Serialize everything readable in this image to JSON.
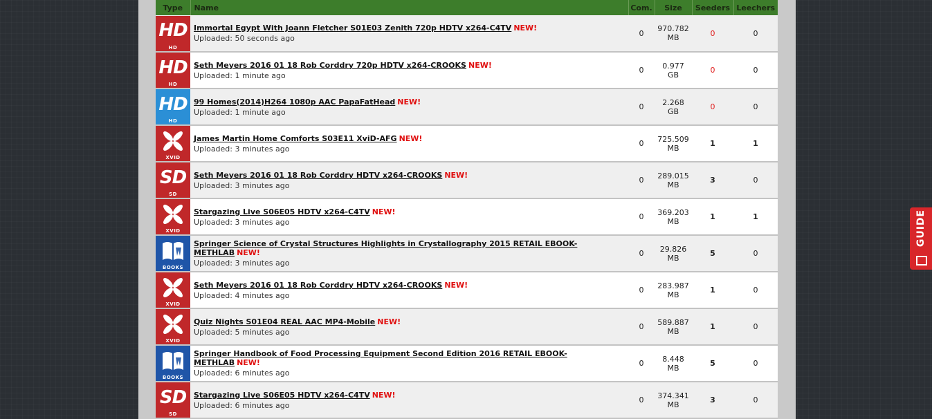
{
  "headers": {
    "type": "Type",
    "name": "Name",
    "com": "Com.",
    "size": "Size",
    "seeders": "Seeders",
    "leechers": "Leechers"
  },
  "new_label": "NEW!",
  "guide_label": "GUIDE",
  "rows": [
    {
      "icon": "hd",
      "icon_text": "HD",
      "icon_label": "HD",
      "color": "#c0282a",
      "name": "Immortal Egypt With Joann Fletcher S01E03 Zenith 720p HDTV x264-C4TV",
      "uploaded": "Uploaded: 50 seconds ago",
      "com": "0",
      "size": "970.782",
      "unit": "MB",
      "seeders": "0",
      "leechers": "0"
    },
    {
      "icon": "hd",
      "icon_text": "HD",
      "icon_label": "HD",
      "color": "#c0282a",
      "name": "Seth Meyers 2016 01 18 Rob Corddry 720p HDTV x264-CROOKS",
      "uploaded": "Uploaded: 1 minute ago",
      "com": "0",
      "size": "0.977",
      "unit": "GB",
      "seeders": "0",
      "leechers": "0"
    },
    {
      "icon": "hd",
      "icon_text": "HD",
      "icon_label": "HD",
      "color": "#2b8fd6",
      "name": "99 Homes(2014)H264 1080p AAC PapaFatHead",
      "uploaded": "Uploaded: 1 minute ago",
      "com": "0",
      "size": "2.268",
      "unit": "GB",
      "seeders": "0",
      "leechers": "0"
    },
    {
      "icon": "xvid",
      "icon_text": "",
      "icon_label": "XVID",
      "color": "#c0282a",
      "name": "James Martin Home Comforts S03E11 XviD-AFG",
      "uploaded": "Uploaded: 3 minutes ago",
      "com": "0",
      "size": "725.509",
      "unit": "MB",
      "seeders": "1",
      "leechers": "1"
    },
    {
      "icon": "sd",
      "icon_text": "SD",
      "icon_label": "SD",
      "color": "#c0282a",
      "name": "Seth Meyers 2016 01 18 Rob Corddry HDTV x264-CROOKS",
      "uploaded": "Uploaded: 3 minutes ago",
      "com": "0",
      "size": "289.015",
      "unit": "MB",
      "seeders": "3",
      "leechers": "0"
    },
    {
      "icon": "xvid",
      "icon_text": "",
      "icon_label": "XVID",
      "color": "#c0282a",
      "name": "Stargazing Live S06E05 HDTV x264-C4TV",
      "uploaded": "Uploaded: 3 minutes ago",
      "com": "0",
      "size": "369.203",
      "unit": "MB",
      "seeders": "1",
      "leechers": "1"
    },
    {
      "icon": "books",
      "icon_text": "",
      "icon_label": "BOOKS",
      "color": "#1f55a8",
      "name": "Springer Science of Crystal Structures Highlights in Crystallography 2015 RETAIL EBOOK-METHLAB",
      "uploaded": "Uploaded: 3 minutes ago",
      "com": "0",
      "size": "29.826",
      "unit": "MB",
      "seeders": "5",
      "leechers": "0"
    },
    {
      "icon": "xvid",
      "icon_text": "",
      "icon_label": "XVID",
      "color": "#c0282a",
      "name": "Seth Meyers 2016 01 18 Rob Corddry HDTV x264-CROOKS",
      "uploaded": "Uploaded: 4 minutes ago",
      "com": "0",
      "size": "283.987",
      "unit": "MB",
      "seeders": "1",
      "leechers": "0"
    },
    {
      "icon": "xvid",
      "icon_text": "",
      "icon_label": "XVID",
      "color": "#c0282a",
      "name": "Quiz Nights S01E04 REAL AAC MP4-Mobile",
      "uploaded": "Uploaded: 5 minutes ago",
      "com": "0",
      "size": "589.887",
      "unit": "MB",
      "seeders": "1",
      "leechers": "0"
    },
    {
      "icon": "books",
      "icon_text": "",
      "icon_label": "BOOKS",
      "color": "#1f55a8",
      "name": "Springer Handbook of Food Processing Equipment Second Edition 2016 RETAIL EBOOK-METHLAB",
      "uploaded": "Uploaded: 6 minutes ago",
      "com": "0",
      "size": "8.448",
      "unit": "MB",
      "seeders": "5",
      "leechers": "0"
    },
    {
      "icon": "sd",
      "icon_text": "SD",
      "icon_label": "SD",
      "color": "#c0282a",
      "name": "Stargazing Live S06E05 HDTV x264-C4TV",
      "uploaded": "Uploaded: 6 minutes ago",
      "com": "0",
      "size": "374.341",
      "unit": "MB",
      "seeders": "3",
      "leechers": "0"
    }
  ]
}
